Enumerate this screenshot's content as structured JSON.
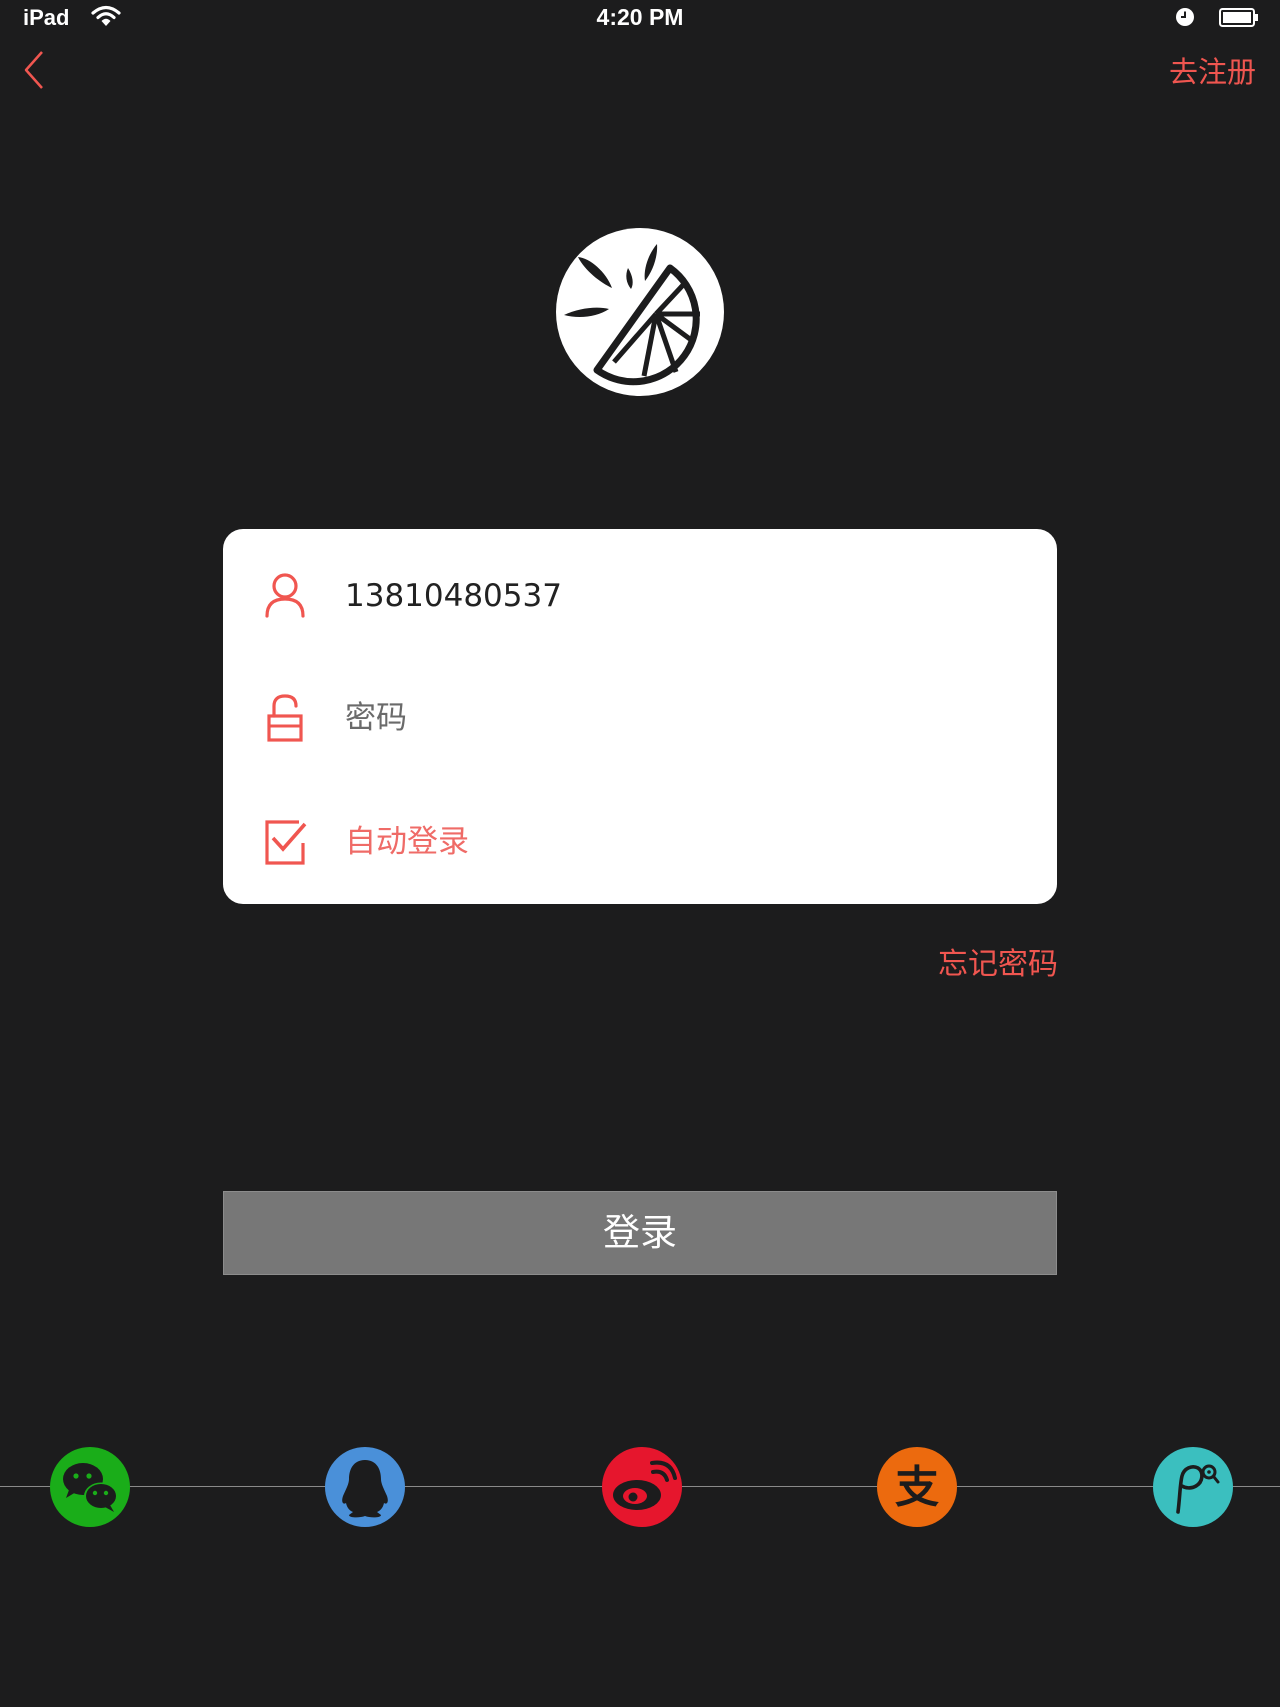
{
  "status_bar": {
    "device": "iPad",
    "time": "4:20 PM",
    "wifi_icon": "wifi-icon",
    "alarm_icon": "clock-icon",
    "battery_icon": "battery-full-icon"
  },
  "nav": {
    "back_icon": "chevron-left-icon",
    "register_label": "去注册"
  },
  "logo": {
    "icon": "lemon-slice-logo"
  },
  "form": {
    "username": {
      "icon": "user-icon",
      "value": "13810480537"
    },
    "password": {
      "icon": "unlock-icon",
      "placeholder": "密码",
      "value": ""
    },
    "auto_login": {
      "icon": "checkbox-checked-icon",
      "label": "自动登录",
      "checked": true
    },
    "forgot_password_label": "忘记密码"
  },
  "login_button": {
    "label": "登录"
  },
  "social_logins": [
    {
      "name": "wechat",
      "icon": "wechat-icon",
      "color": "#1aad19"
    },
    {
      "name": "qq",
      "icon": "qq-penguin-icon",
      "color": "#4a90d9"
    },
    {
      "name": "weibo",
      "icon": "weibo-icon",
      "color": "#e6162d"
    },
    {
      "name": "alipay",
      "icon": "alipay-icon",
      "color": "#ec6a0e"
    },
    {
      "name": "p-app",
      "icon": "p-app-icon",
      "color": "#3bbfbf"
    }
  ],
  "colors": {
    "background": "#1c1c1d",
    "accent": "#f05650",
    "card": "#ffffff",
    "button": "#777777"
  }
}
